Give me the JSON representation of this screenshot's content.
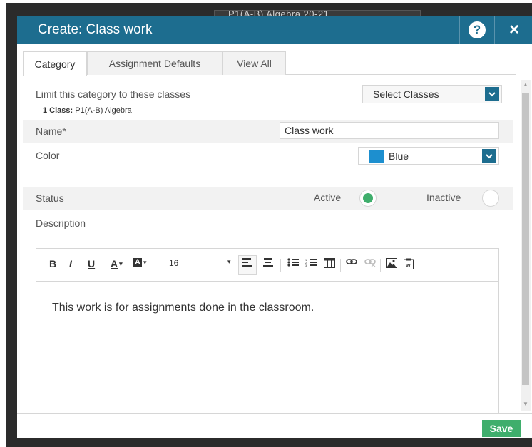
{
  "background": {
    "window_text": "P1(A-B) Algebra 20-21"
  },
  "dialog": {
    "title": "Create: Class work",
    "help_label": "?",
    "close_label": "×"
  },
  "tabs": [
    {
      "label": "Category",
      "active": true
    },
    {
      "label": "Assignment Defaults",
      "active": false
    },
    {
      "label": "View All",
      "active": false
    }
  ],
  "limit": {
    "label": "Limit this category to these classes",
    "count_bold": "1 Class:",
    "count_rest": " P1(A-B) Algebra",
    "select_label": "Select Classes"
  },
  "fields": {
    "name_label": "Name*",
    "name_value": "Class work",
    "color_label": "Color",
    "color_value": "Blue",
    "color_hex": "#1d8fcf",
    "status_label": "Status",
    "status_active": "Active",
    "status_inactive": "Inactive",
    "status_selected": "Active",
    "description_label": "Description"
  },
  "editor": {
    "toolbar": {
      "bold": "B",
      "italic": "I",
      "underline": "U",
      "font_color": "A",
      "highlight": "A",
      "font_size": "16"
    },
    "body_text": "This work is for assignments done in the classroom."
  },
  "footer": {
    "save_label": "Save"
  },
  "colors": {
    "accent": "#1d6d8f",
    "save_green": "#3fae6c",
    "shaded_row": "#f2f2f2"
  }
}
